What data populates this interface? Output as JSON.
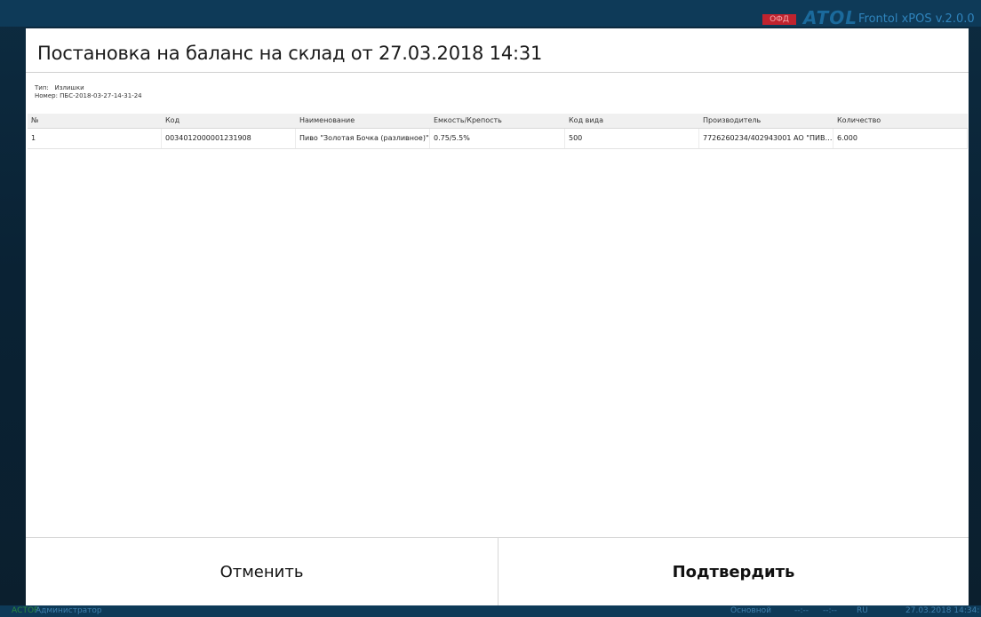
{
  "app": {
    "ofd_badge": "ОФД",
    "brand_logo": "ATOL",
    "title": "Frontol xPOS v.2.0.0"
  },
  "dialog": {
    "title": "Постановка на баланс на склад от 27.03.2018 14:31",
    "type_label": "Тип:",
    "type_value": "Излишки",
    "number_label": "Номер:",
    "number_value": "ПБС-2018-03-27-14-31-24"
  },
  "table": {
    "columns": [
      "№",
      "Код",
      "Наименование",
      "Емкость/Крепость",
      "Код вида",
      "Производитель",
      "Количество"
    ],
    "rows": [
      [
        "1",
        "0034012000001231908",
        "Пиво \"Золотая Бочка (разливное)\"",
        "0.75/5.5%",
        "500",
        "7726260234/402943001 АО \"ПИВОВАРЕННАЯ КОМПАНИЯ\"",
        "6.000"
      ]
    ]
  },
  "buttons": {
    "cancel": "Отменить",
    "confirm": "Подтвердить"
  },
  "statusbar": {
    "mode": "АСТОР",
    "user": "Администратор",
    "profile": "Основной",
    "time1": "--:--",
    "time2": "--:--",
    "lang": "RU",
    "clock": "27.03.2018 14:34:"
  }
}
